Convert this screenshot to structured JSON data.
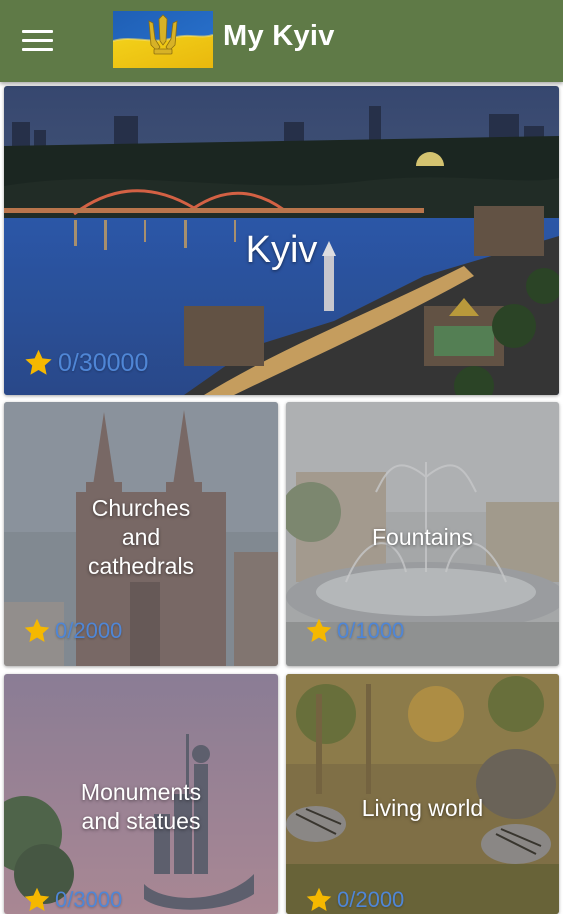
{
  "app": {
    "title": "My Kyiv",
    "colors": {
      "appbar": "#5f7a47",
      "star": "#f5b800",
      "score": "#4f86d6"
    }
  },
  "header": {
    "menu_icon": "menu-icon",
    "logo": "ukraine-flag-trident-icon"
  },
  "hero": {
    "title": "Kyiv",
    "score": "0/30000"
  },
  "categories": [
    {
      "label_lines": [
        "Churches",
        "and",
        "cathedrals"
      ],
      "score": "0/2000"
    },
    {
      "label_lines": [
        "Fountains"
      ],
      "score": "0/1000"
    },
    {
      "label_lines": [
        "Monuments",
        "and statues"
      ],
      "score": "0/3000"
    },
    {
      "label_lines": [
        "Living world"
      ],
      "score": "0/2000"
    }
  ]
}
